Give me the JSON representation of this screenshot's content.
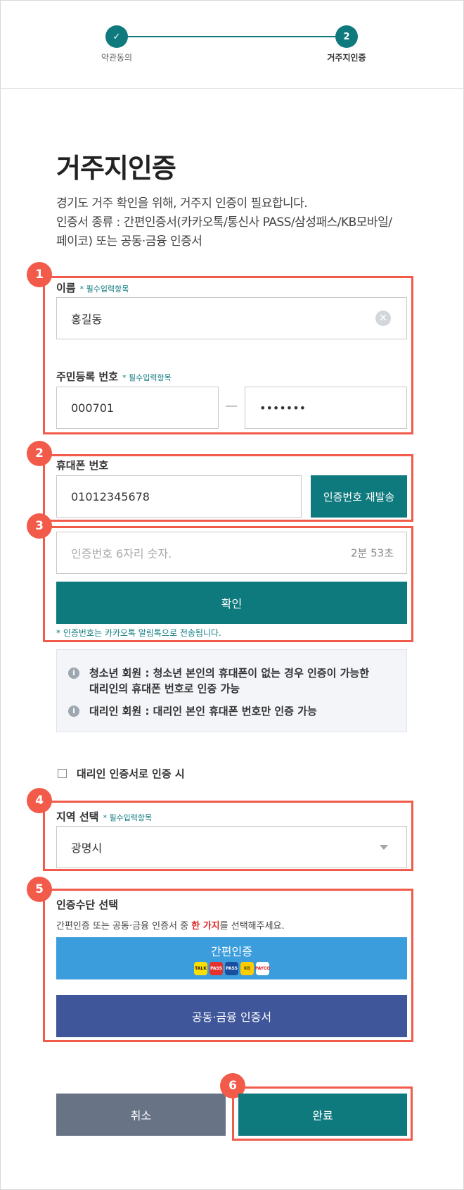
{
  "stepper": {
    "steps": [
      {
        "label": "약관동의",
        "marker": "✓",
        "state": "done"
      },
      {
        "label": "거주지인증",
        "marker": "2",
        "state": "active"
      }
    ]
  },
  "page": {
    "title": "거주지인증",
    "desc1": "경기도 거주 확인을 위해, 거주지 인증이 필요합니다.",
    "desc2": "인증서 종류 : 간편인증서(카카오톡/통신사 PASS/삼성패스/KB모바일/",
    "desc3": "페이코) 또는 공동·금융 인증서"
  },
  "badges": [
    "1",
    "2",
    "3",
    "4",
    "5",
    "6"
  ],
  "form": {
    "required_text": "필수입력항목",
    "name_label": "이름",
    "name_value": "홍길동",
    "rrn_label": "주민등록 번호",
    "rrn_front": "000701",
    "rrn_sep": "—",
    "rrn_back": "•••••••",
    "phone_label": "휴대폰 번호",
    "phone_value": "01012345678",
    "resend_button": "인증번호 재발송",
    "code_placeholder": "인증번호 6자리 숫자.",
    "timer": "2분 53초",
    "confirm_button": "확인",
    "kakao_note": "* 인증번호는 카카오톡 알림톡으로 전송됩니다."
  },
  "info": {
    "line1a": "청소년 회원 : 청소년 본인의 휴대폰이 없는 경우 인증이 가능한",
    "line1b": "대리인의 휴대폰 번호로 인증 가능",
    "line2": "대리인 회원 : 대리인 본인 휴대폰 번호만 인증 가능"
  },
  "proxy_checkbox": {
    "label": "대리인 인증서로 인증 시",
    "checked": false
  },
  "region": {
    "label": "지역 선택",
    "value": "광명시"
  },
  "auth_method": {
    "label": "인증수단 선택",
    "desc_pre": "간편인증 또는 공동·금융 인증서 중 ",
    "desc_em": "한 가지",
    "desc_post": "를 선택해주세요.",
    "simple_button": "간편인증",
    "cert_button": "공동·금융 인증서",
    "pay_icons": [
      "TALK",
      "PASS",
      "PASS",
      "KB",
      "PAYCO"
    ]
  },
  "footer": {
    "cancel": "취소",
    "complete": "완료"
  },
  "colors": {
    "teal": "#0f7a7e",
    "highlight": "#f25a4a",
    "blue": "#3b9ddc",
    "navy": "#3f569b",
    "gray": "#687486"
  }
}
